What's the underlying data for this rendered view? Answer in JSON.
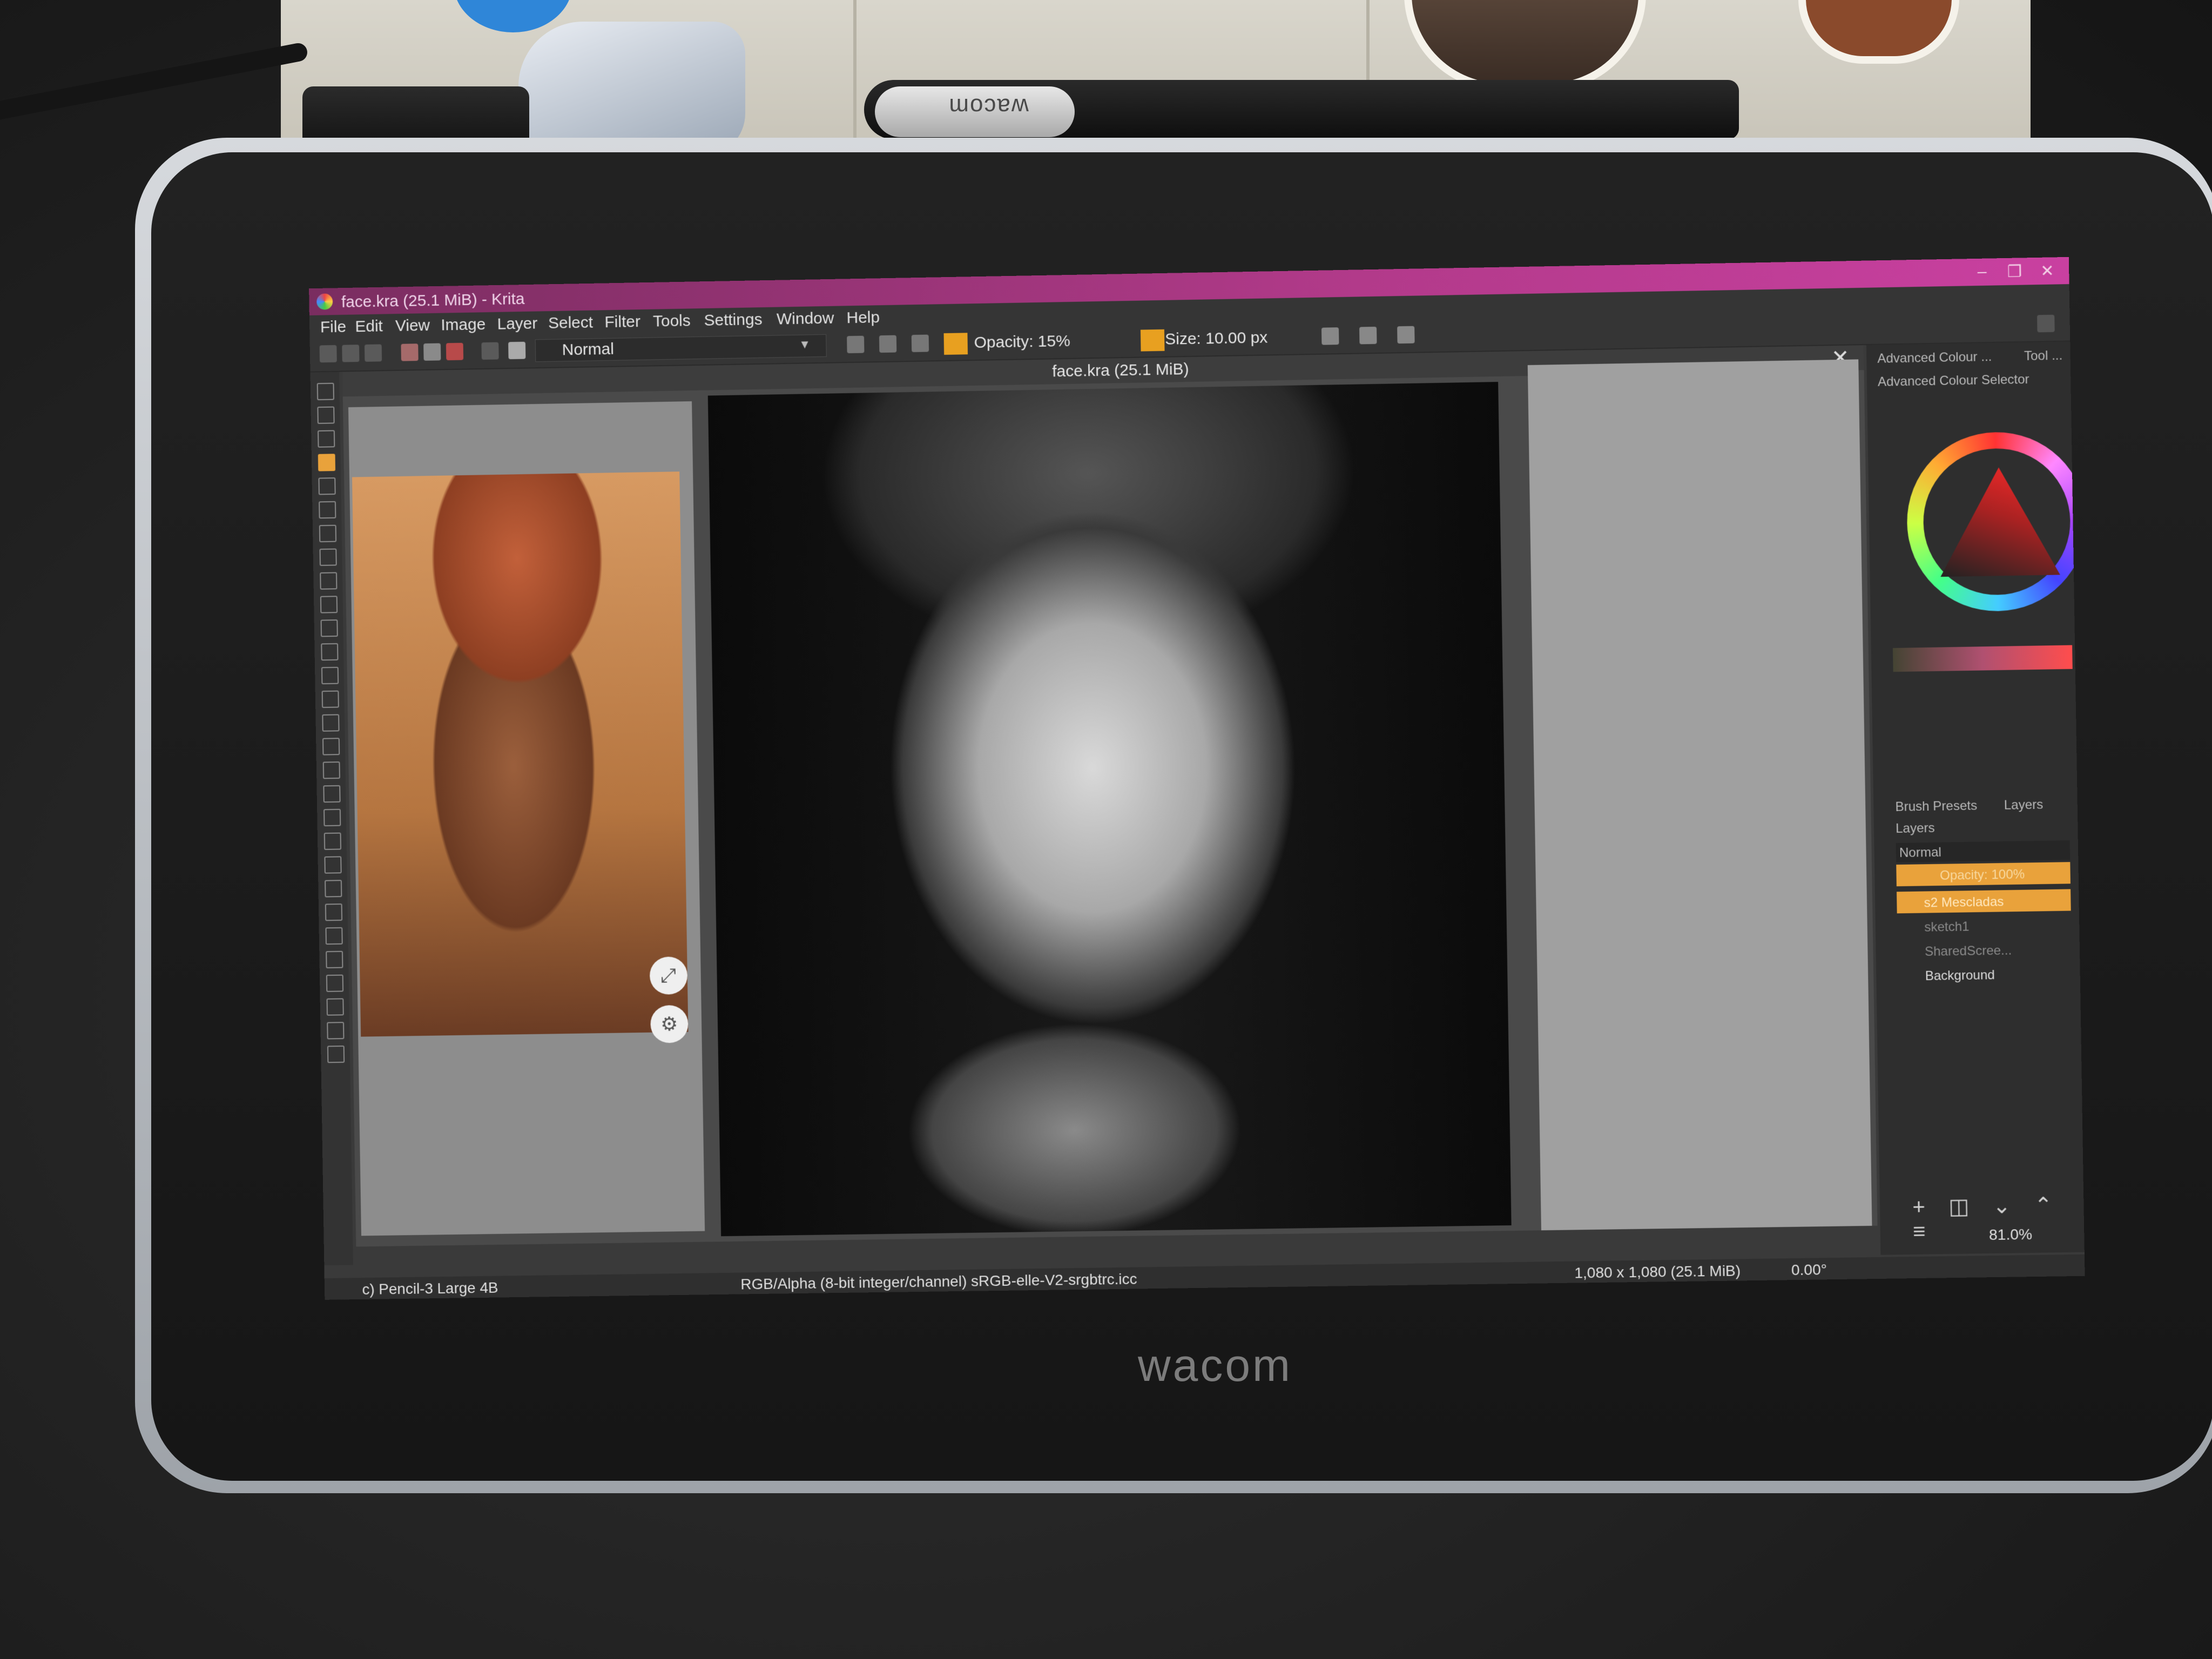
{
  "window": {
    "title": "face.kra (25.1 MiB) - Krita",
    "minimize": "–",
    "maximize": "❐",
    "close": "✕"
  },
  "menu": [
    "File",
    "Edit",
    "View",
    "Image",
    "Layer",
    "Select",
    "Filter",
    "Tools",
    "Settings",
    "Window",
    "Help"
  ],
  "toolbar": {
    "blend_mode": "Normal",
    "opacity": "Opacity: 15%",
    "size": "Size: 10.00 px"
  },
  "document": {
    "tab_title": "face.kra (25.1 MiB)",
    "close_icon": "✕"
  },
  "status": {
    "brush": "c) Pencil-3 Large 4B",
    "color_space": "RGB/Alpha (8-bit integer/channel)  sRGB-elle-V2-srgbtrc.icc",
    "image_info": "1,080 x 1,080 (25.1 MiB)",
    "rotation": "0.00°",
    "zoom": "81.0%"
  },
  "dockers": {
    "tab_colour": "Advanced Colour ...",
    "tab_tool": "Tool ...",
    "colour_selector_title": "Advanced Colour Selector",
    "tab_brush_presets": "Brush Presets",
    "tab_layers": "Layers",
    "layers_title": "Layers",
    "layers_blend": "Normal",
    "layers_opacity": "Opacity: 100%"
  },
  "layers": [
    {
      "name": "s2 Mescladas",
      "active": true
    },
    {
      "name": "sketch1",
      "active": false
    },
    {
      "name": "SharedScree...",
      "active": false
    },
    {
      "name": "Background",
      "active": false
    }
  ],
  "hardware": {
    "tablet_brand": "wacom",
    "stylus_brand": "wacom"
  },
  "colors": {
    "titlebar": "#b23a8a",
    "accent": "#e9a23b",
    "fg_color": "#e8a020"
  },
  "icons": {
    "reference_expand": "expand-icon",
    "reference_settings": "settings-icon"
  }
}
